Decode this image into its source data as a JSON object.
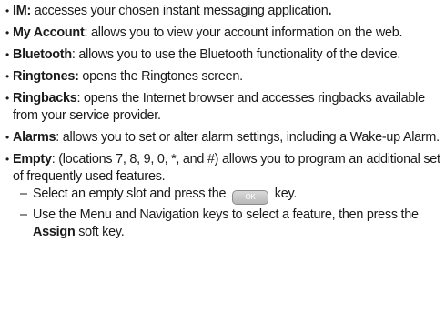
{
  "bullet": "•",
  "dash": "–",
  "items": [
    {
      "term": "IM:",
      "text": " accesses your chosen instant messaging application",
      "trail": "."
    },
    {
      "term": "My Account",
      "text": ": allows you to view your account information on the web."
    },
    {
      "term": "Bluetooth",
      "text": ": allows you to use the Bluetooth functionality of the device."
    },
    {
      "term": "Ringtones:",
      "text": " opens the Ringtones screen."
    },
    {
      "term": "Ringbacks",
      "text": ": opens the Internet browser and accesses ringbacks available from your service provider."
    },
    {
      "term": "Alarms",
      "text": ": allows you to set or alter alarm settings, including a Wake-up Alarm."
    },
    {
      "term": "Empty",
      "text": ": (locations 7, 8, 9, 0, *, and #) allows you to program an additional set of frequently used features."
    }
  ],
  "sub_items": [
    {
      "before": "Select an empty slot and press the",
      "key": "OK",
      "after": "key."
    },
    {
      "before": "Use the Menu and Navigation keys to select a feature, then press the ",
      "bold": "Assign",
      "after": " soft key."
    }
  ]
}
